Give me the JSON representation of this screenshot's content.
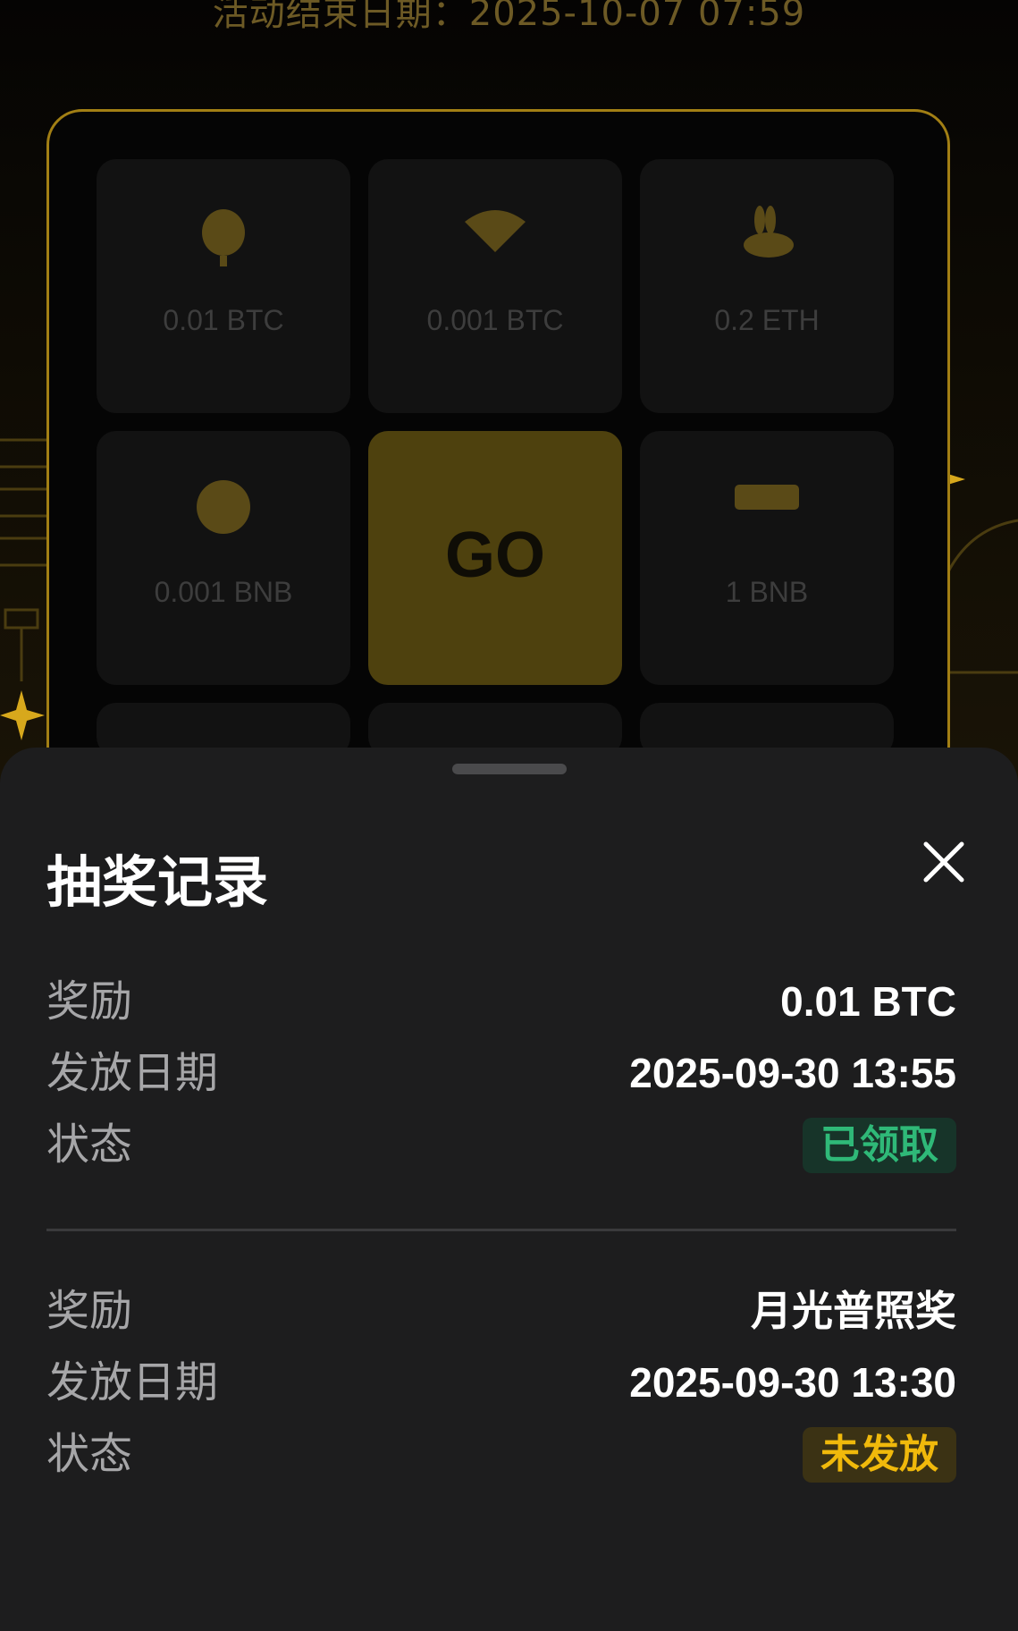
{
  "activity": {
    "end_date_text": "活动结束日期：2025-10-07 07:59"
  },
  "prize_grid": {
    "cells": [
      {
        "label": "0.01 BTC",
        "icon": "lantern-icon"
      },
      {
        "label": "0.001 BTC",
        "icon": "fan-icon"
      },
      {
        "label": "0.2 ETH",
        "icon": "rabbit-icon"
      },
      {
        "label": "0.001 BNB",
        "icon": "mooncake-icon"
      },
      {
        "label": "GO",
        "icon": "go-button"
      },
      {
        "label": "1 BNB",
        "icon": "gold-bar-icon"
      }
    ]
  },
  "sheet": {
    "title": "抽奖记录",
    "close_icon": "close-icon",
    "records": [
      {
        "reward_label": "奖励",
        "reward_value": "0.01 BTC",
        "date_label": "发放日期",
        "date_value": "2025-09-30 13:55",
        "status_label": "状态",
        "status_value": "已领取",
        "status_color": "#2fb978"
      },
      {
        "reward_label": "奖励",
        "reward_value": "月光普照奖",
        "date_label": "发放日期",
        "date_value": "2025-09-30 13:30",
        "status_label": "状态",
        "status_value": "未发放",
        "status_color": "#f0b90b"
      }
    ]
  },
  "colors": {
    "accent_gold": "#f0b90b",
    "success_green": "#2fb978",
    "sheet_bg": "#1d1d1e"
  }
}
